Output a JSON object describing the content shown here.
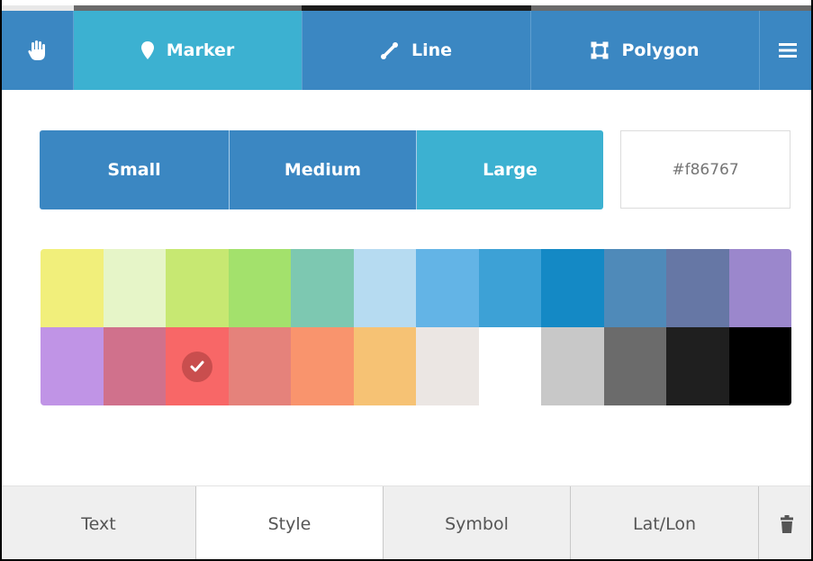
{
  "toolbar": {
    "hand_icon": "hand-icon",
    "tools": [
      {
        "label": "Marker",
        "icon": "map-pin-icon",
        "active": true
      },
      {
        "label": "Line",
        "icon": "line-icon",
        "active": false
      },
      {
        "label": "Polygon",
        "icon": "polygon-icon",
        "active": false
      }
    ],
    "menu_icon": "menu-icon"
  },
  "size": {
    "options": [
      "Small",
      "Medium",
      "Large"
    ],
    "selected": "Large"
  },
  "color_input": {
    "placeholder": "#f86767",
    "value": ""
  },
  "palette": {
    "selected_index": 14,
    "colors": [
      "#f1ef7b",
      "#e6f5c8",
      "#c7e872",
      "#a3e16c",
      "#7dc8b1",
      "#b6dbf1",
      "#63b4e6",
      "#3da1d6",
      "#1489c5",
      "#4f8ab9",
      "#6677a5",
      "#9b87cc",
      "#c094e6",
      "#d0718c",
      "#f86767",
      "#e5827b",
      "#f9946d",
      "#f6c274",
      "#ebe6e3",
      "#ffffff",
      "#c8c8c8",
      "#6b6b6b",
      "#1f1f1f",
      "#000000"
    ]
  },
  "tabs": [
    {
      "label": "Text",
      "active": false
    },
    {
      "label": "Style",
      "active": true
    },
    {
      "label": "Symbol",
      "active": false
    },
    {
      "label": "Lat/Lon",
      "active": false
    }
  ],
  "trash_icon": "trash-icon",
  "colors": {
    "toolbar_bg": "#3b87c2",
    "active_bg": "#3cb1d1"
  }
}
